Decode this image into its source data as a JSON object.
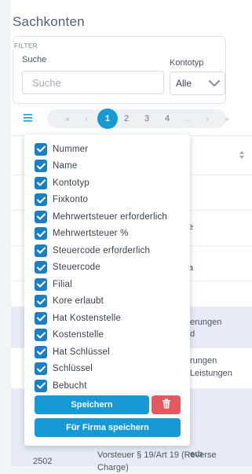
{
  "page": {
    "title": "Sachkonten"
  },
  "filter": {
    "legend": "FILTER",
    "search_label": "Suche",
    "search_placeholder": "Suche",
    "type_label": "Kontotyp",
    "type_value": "Alle"
  },
  "pagination": {
    "first": "«",
    "prev": "‹",
    "pages": [
      "1",
      "2",
      "3",
      "4"
    ],
    "ellipsis": "…",
    "next": "›",
    "last": "»",
    "current": "1"
  },
  "table": {
    "rows": [
      {
        "text": "e"
      },
      {
        "text": "a"
      },
      {
        "text_line1": "erungen",
        "text_line2": "d"
      },
      {
        "text_line1": "rungen",
        "text_line2": "Leistungen"
      },
      {
        "text": "erb"
      },
      {
        "number": "2502",
        "text_line1": "Vorsteuer § 19/Art 19 (Reverse",
        "text_line2": "Charge)"
      }
    ]
  },
  "columns_menu": {
    "options": [
      {
        "label": "Nummer",
        "checked": true
      },
      {
        "label": "Name",
        "checked": true
      },
      {
        "label": "Kontotyp",
        "checked": true
      },
      {
        "label": "Fixkonto",
        "checked": true
      },
      {
        "label": "Mehrwertsteuer erforderlich",
        "checked": true
      },
      {
        "label": "Mehrwertsteuer %",
        "checked": true
      },
      {
        "label": "Steuercode erforderlich",
        "checked": true
      },
      {
        "label": "Steuercode",
        "checked": true
      },
      {
        "label": "Filial",
        "checked": true
      },
      {
        "label": "Kore erlaubt",
        "checked": true
      },
      {
        "label": "Hat Kostenstelle",
        "checked": true
      },
      {
        "label": "Kostenstelle",
        "checked": true
      },
      {
        "label": "Hat Schlüssel",
        "checked": true
      },
      {
        "label": "Schlüssel",
        "checked": true
      },
      {
        "label": "Bebucht",
        "checked": true
      }
    ],
    "save_label": "Speichern",
    "save_company_label": "Für Firma speichern"
  },
  "colors": {
    "accent": "#1799d6",
    "checkbox": "#1a7fc4",
    "danger": "#e25a5f",
    "row_highlight": "#e8ebf6"
  }
}
